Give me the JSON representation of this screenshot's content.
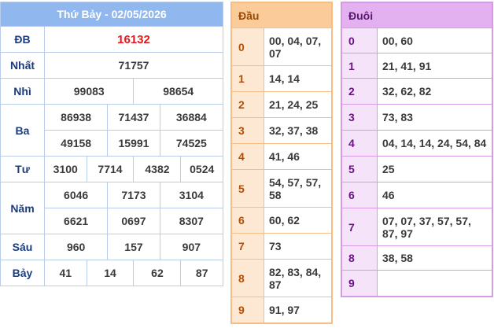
{
  "result": {
    "title": "Thứ Bảy - 02/05/2026",
    "prizes": {
      "db": {
        "label": "ĐB",
        "values": [
          "16132"
        ]
      },
      "nhat": {
        "label": "Nhất",
        "values": [
          "71757"
        ]
      },
      "nhi": {
        "label": "Nhì",
        "values": [
          "99083",
          "98654"
        ]
      },
      "ba": {
        "label": "Ba",
        "values": [
          "86938",
          "71437",
          "36884",
          "49158",
          "15991",
          "74525"
        ]
      },
      "tu": {
        "label": "Tư",
        "values": [
          "3100",
          "7714",
          "4382",
          "0524"
        ]
      },
      "nam": {
        "label": "Năm",
        "values": [
          "6046",
          "7173",
          "3104",
          "6621",
          "0697",
          "8307"
        ]
      },
      "sau": {
        "label": "Sáu",
        "values": [
          "960",
          "157",
          "907"
        ]
      },
      "bay": {
        "label": "Bảy",
        "values": [
          "41",
          "14",
          "62",
          "87"
        ]
      }
    }
  },
  "dau": {
    "header": "Đầu",
    "rows": [
      {
        "k": "0",
        "v": "00, 04, 07, 07"
      },
      {
        "k": "1",
        "v": "14, 14"
      },
      {
        "k": "2",
        "v": "21, 24, 25"
      },
      {
        "k": "3",
        "v": "32, 37, 38"
      },
      {
        "k": "4",
        "v": "41, 46"
      },
      {
        "k": "5",
        "v": "54, 57, 57, 58"
      },
      {
        "k": "6",
        "v": "60, 62"
      },
      {
        "k": "7",
        "v": "73"
      },
      {
        "k": "8",
        "v": "82, 83, 84, 87"
      },
      {
        "k": "9",
        "v": "91, 97"
      }
    ]
  },
  "duoi": {
    "header": "Đuôi",
    "rows": [
      {
        "k": "0",
        "v": "00, 60"
      },
      {
        "k": "1",
        "v": "21, 41, 91"
      },
      {
        "k": "2",
        "v": "32, 62, 82"
      },
      {
        "k": "3",
        "v": "73, 83"
      },
      {
        "k": "4",
        "v": "04, 14, 14, 24, 54, 84"
      },
      {
        "k": "5",
        "v": "25"
      },
      {
        "k": "6",
        "v": "46"
      },
      {
        "k": "7",
        "v": "07, 07, 37, 57, 57, 87, 97"
      },
      {
        "k": "8",
        "v": "38, 58"
      },
      {
        "k": "9",
        "v": ""
      }
    ]
  },
  "colors": {
    "result_header": "#90b8ef",
    "special_prize": "#e8151b",
    "dau_border": "#f6bd85",
    "duoi_border": "#d69be4"
  }
}
